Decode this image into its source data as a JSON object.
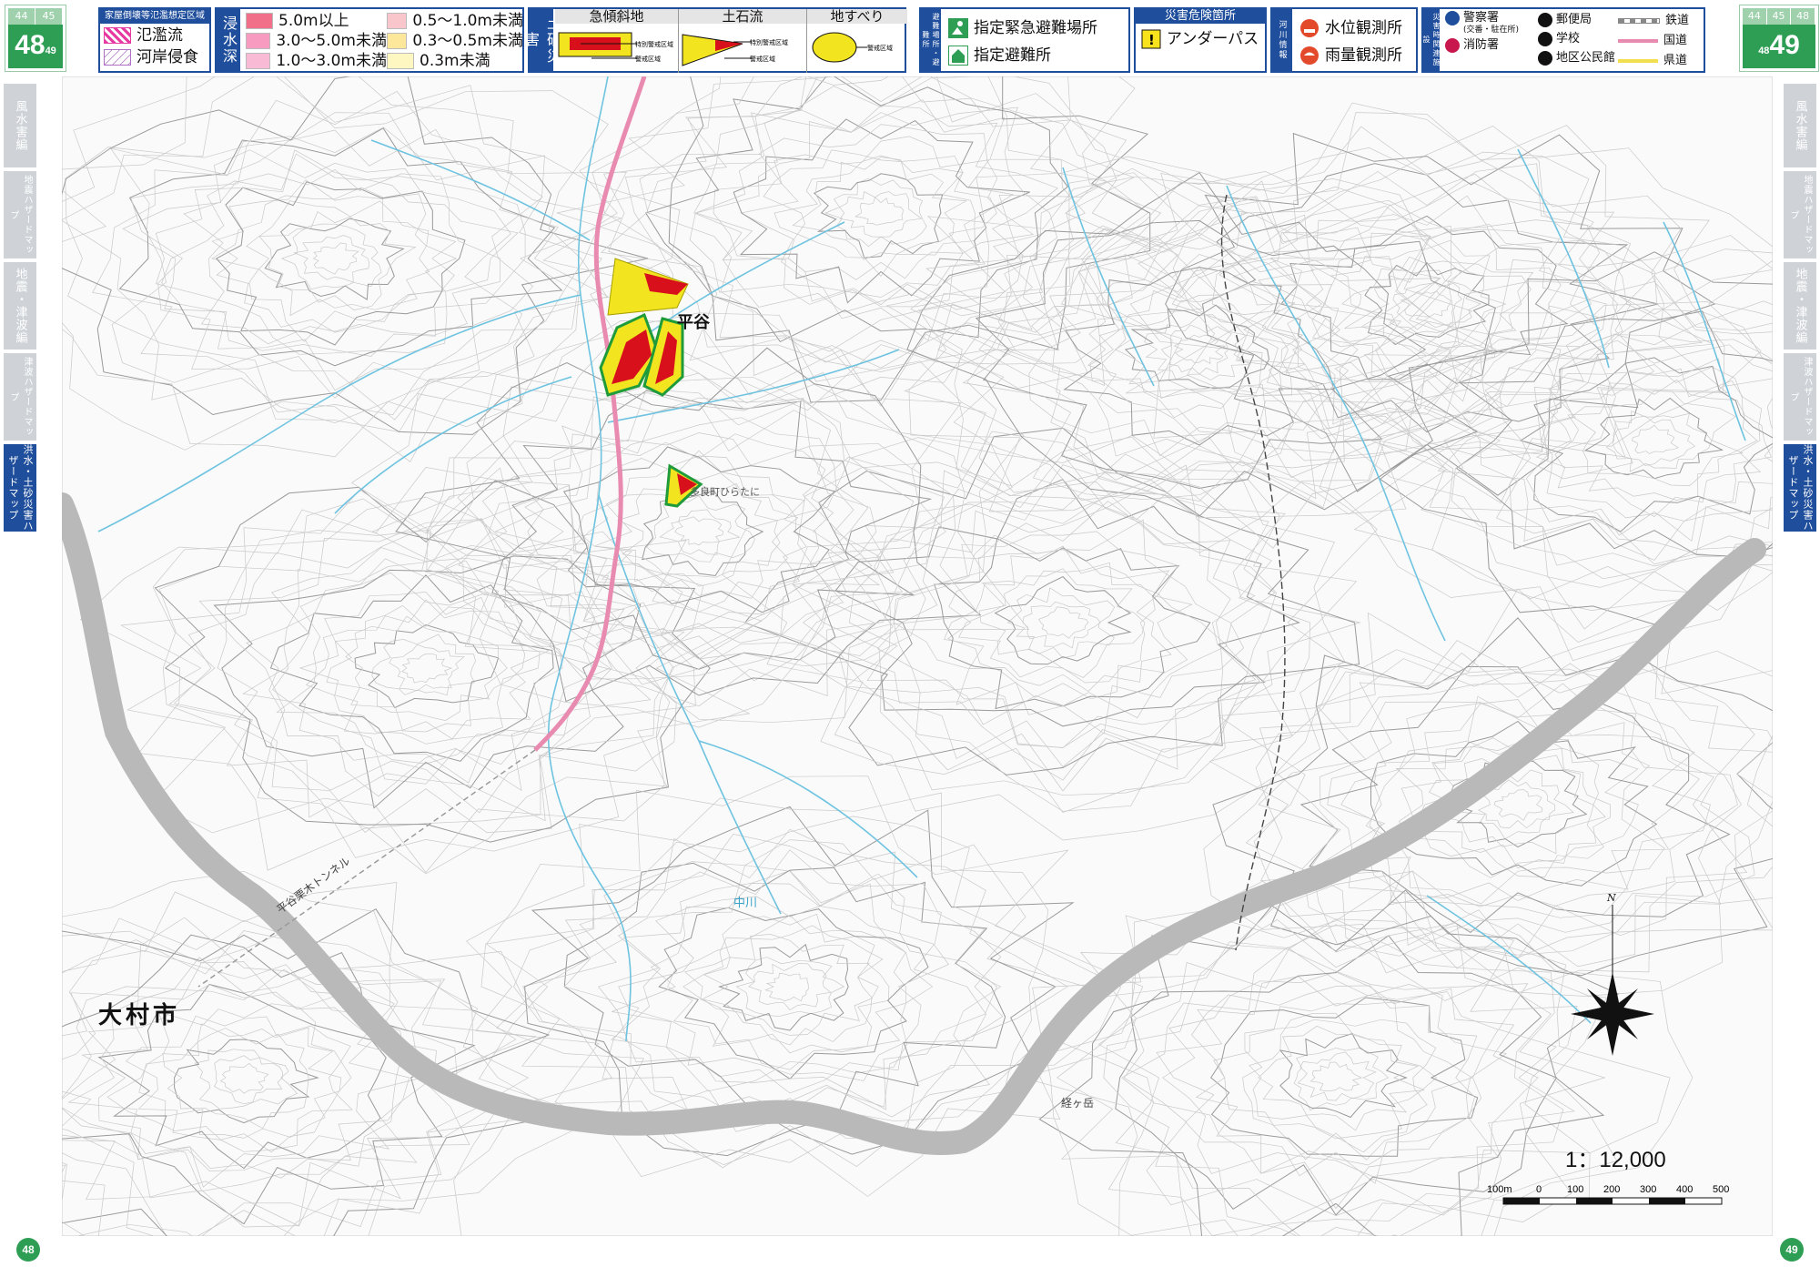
{
  "page_left": {
    "tabs": [
      "44",
      "45"
    ],
    "number": "48",
    "footer_number": "48",
    "small_sub": "49"
  },
  "page_right": {
    "tabs": [
      "44",
      "45",
      "48"
    ],
    "number": "49",
    "footer_number": "49",
    "small_sub": "48"
  },
  "legend_flood_zone": {
    "title": "家屋倒壊等氾濫想定区域",
    "items": [
      {
        "label": "氾濫流",
        "color": "#e63aa2"
      },
      {
        "label": "河岸侵食",
        "color": "#b06fc4"
      }
    ]
  },
  "legend_depth": {
    "side_label": "浸水深",
    "items": [
      {
        "label": "5.0m以上",
        "color": "#f26f8a"
      },
      {
        "label": "0.5～1.0m未満",
        "color": "#f9c6cc"
      },
      {
        "label": "3.0～5.0m未満",
        "color": "#f79cc0"
      },
      {
        "label": "0.3～0.5m未満",
        "color": "#fde79a"
      },
      {
        "label": "1.0～3.0m未満",
        "color": "#f9bad6"
      },
      {
        "label": "0.3m未満",
        "color": "#fff7c2"
      }
    ]
  },
  "legend_sediment": {
    "side_label": "土砂災害",
    "columns": [
      {
        "title": "急傾斜地",
        "labels": [
          "特別警戒区域",
          "警戒区域"
        ]
      },
      {
        "title": "土石流",
        "labels": [
          "特別警戒区域",
          "警戒区域"
        ]
      },
      {
        "title": "地すべり",
        "labels": [
          "警戒区域"
        ]
      }
    ]
  },
  "legend_evac": {
    "side_label": "避難場所・避難所",
    "items": [
      {
        "label": "指定緊急避難場所",
        "icon": "emergency-shelter-icon"
      },
      {
        "label": "指定避難所",
        "icon": "shelter-icon"
      }
    ]
  },
  "legend_danger": {
    "title": "災害危険箇所",
    "items": [
      {
        "label": "アンダーパス",
        "icon": "warning-icon"
      }
    ]
  },
  "legend_river": {
    "side_label": "河川情報",
    "items": [
      {
        "label": "水位観測所",
        "icon": "water-level-icon"
      },
      {
        "label": "雨量観測所",
        "icon": "rain-gauge-icon"
      }
    ]
  },
  "legend_facilities": {
    "side_label": "災害時関連施設",
    "items": [
      {
        "label": "警察署",
        "sub": "(交番・駐在所)",
        "icon": "police-icon"
      },
      {
        "label": "郵便局",
        "icon": "post-office-icon"
      },
      {
        "label": "消防署",
        "icon": "fire-station-icon"
      },
      {
        "label": "学校",
        "icon": "school-icon"
      },
      {
        "label": "地区公民館",
        "icon": "community-center-icon"
      }
    ],
    "lines": [
      {
        "label": "鉄道",
        "color": "#888888"
      },
      {
        "label": "国道",
        "color": "#e98bb0"
      },
      {
        "label": "県道",
        "color": "#f2df4f"
      }
    ]
  },
  "side_tabs_left": [
    "風水害編",
    "地震ハザードマップ",
    "地震・津波編",
    "津波ハザードマップ",
    "洪水・土砂災害ハザードマップ"
  ],
  "side_tabs_right": [
    "風水害編",
    "地震ハザードマップ",
    "地震・津波編",
    "津波ハザードマップ",
    "洪水・土砂災害ハザードマップ"
  ],
  "map": {
    "place_labels": [
      {
        "text": "平谷"
      },
      {
        "text": "大村市"
      },
      {
        "text": "中川"
      },
      {
        "text": "平谷栗木トンネル"
      },
      {
        "text": "経ヶ岳"
      },
      {
        "text": "多良町ひらたに"
      }
    ],
    "north_label": "N",
    "scale_text": "1：12,000",
    "scale_ticks": [
      "100m",
      "0",
      "100",
      "200",
      "300",
      "400",
      "500"
    ]
  },
  "colors": {
    "brand_blue": "#1f4e9c",
    "page_green": "#2e9e55",
    "river": "#6ec3e0",
    "road": "#e98bb0"
  }
}
